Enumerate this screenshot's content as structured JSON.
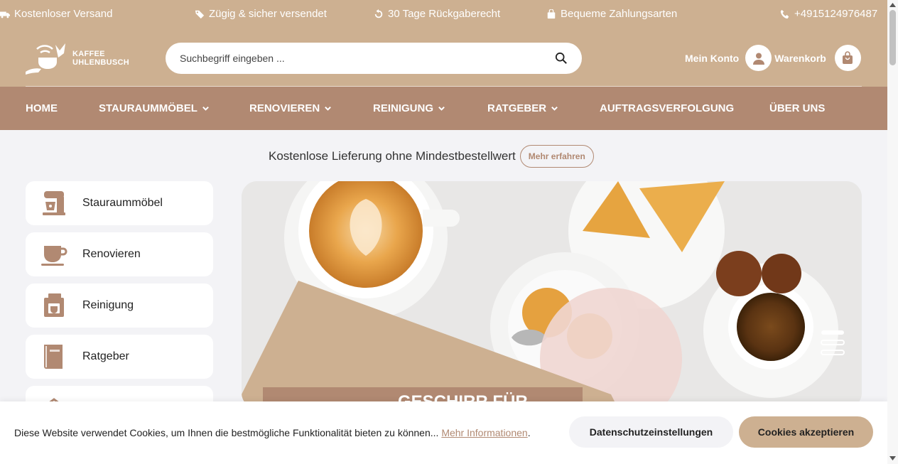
{
  "infobar": {
    "shipping": "Kostenloser Versand",
    "fast": "Zügig & sicher versendet",
    "returns": "30 Tage Rückgaberecht",
    "payment": "Bequeme Zahlungsarten",
    "phone": "+4915124976487"
  },
  "logo": {
    "line1": "KAFFEE",
    "line2": "UHLENBUSCH"
  },
  "search": {
    "placeholder": "Suchbegriff eingeben ..."
  },
  "header": {
    "account_label": "Mein Konto",
    "cart_label": "Warenkorb"
  },
  "nav": {
    "items": [
      {
        "label": "HOME"
      },
      {
        "label": "STAURAUMMÖBEL"
      },
      {
        "label": "RENOVIEREN"
      },
      {
        "label": "REINIGUNG"
      },
      {
        "label": "RATGEBER"
      },
      {
        "label": "AUFTRAGSVERFOLGUNG"
      },
      {
        "label": "ÜBER UNS"
      }
    ]
  },
  "promo": {
    "text": "Kostenlose Lieferung ohne Mindestbestellwert",
    "button": "Mehr erfahren"
  },
  "categories": [
    {
      "label": "Stauraummöbel",
      "icon": "mixer-icon"
    },
    {
      "label": "Renovieren",
      "icon": "cup-icon"
    },
    {
      "label": "Reinigung",
      "icon": "coffee-machine-icon"
    },
    {
      "label": "Ratgeber",
      "icon": "book-icon"
    },
    {
      "label": "",
      "icon": "house-icon"
    }
  ],
  "hero": {
    "headline": "GESCHIRR FÜR"
  },
  "cookie": {
    "text": "Diese Website verwendet Cookies, um Ihnen die bestmögliche Funktionalität bieten zu können...",
    "link": "Mehr Informationen",
    "privacy_button": "Datenschutzeinstellungen",
    "accept_button": "Cookies akzeptieren"
  },
  "colors": {
    "tan": "#cdb091",
    "brown": "#b18972",
    "background": "#f3f3f6"
  }
}
